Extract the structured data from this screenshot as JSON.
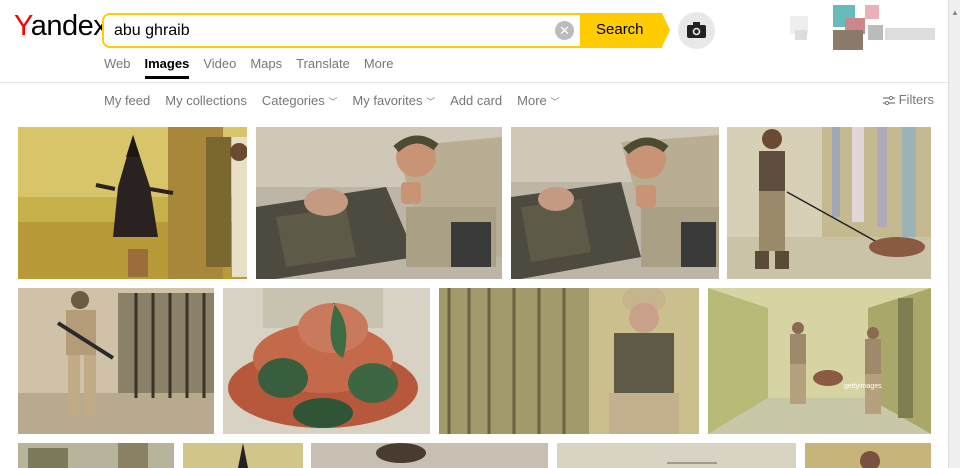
{
  "logo": {
    "first": "Y",
    "rest": "andex"
  },
  "search": {
    "query": "abu ghraib",
    "button_label": "Search"
  },
  "tabs": [
    {
      "label": "Web"
    },
    {
      "label": "Images",
      "active": true
    },
    {
      "label": "Video"
    },
    {
      "label": "Maps"
    },
    {
      "label": "Translate"
    },
    {
      "label": "More"
    }
  ],
  "subnav": {
    "my_feed": "My feed",
    "my_collections": "My collections",
    "categories": "Categories",
    "my_favorites": "My favorites",
    "add_card": "Add card",
    "more": "More",
    "filters": "Filters"
  },
  "colors": {
    "accent": "#ffcc00",
    "logo_red": "#ff0000"
  },
  "results": {
    "row1": [
      "hooded-prisoner-photo",
      "soldier-thumbs-up-photo",
      "soldier-thumbs-up-photo",
      "soldier-leash-photo"
    ],
    "row2": [
      "armed-soldier-doorway-photo",
      "prisoner-pile-photo",
      "soldier-corridor-photo",
      "guards-corridor-photo"
    ],
    "watermark": "gettyimages"
  }
}
